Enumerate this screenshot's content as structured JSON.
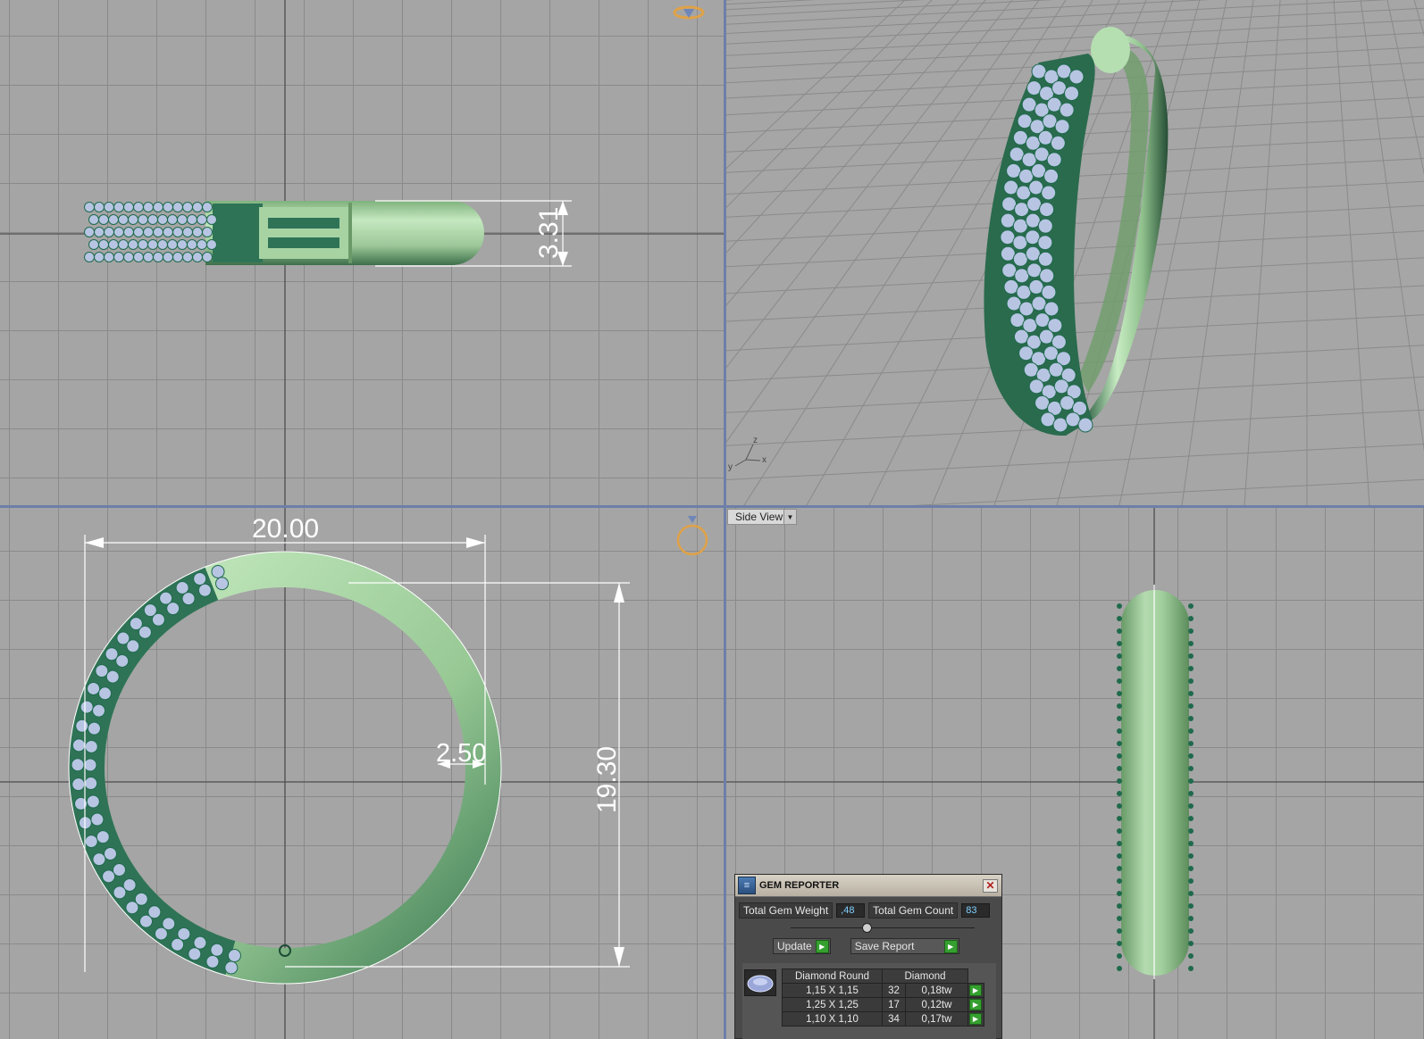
{
  "viewports": {
    "side": {
      "view_label": "Side View"
    }
  },
  "dimensions": {
    "thickness": "3.31",
    "width": "20.00",
    "height": "19.30",
    "band_width": "2.50"
  },
  "axes": {
    "x": "x",
    "y": "y",
    "z": "z"
  },
  "gem_reporter": {
    "title": "GEM REPORTER",
    "total_weight_label": "Total Gem Weight",
    "total_weight_value": ",48",
    "total_count_label": "Total Gem Count",
    "total_count_value": "83",
    "update_label": "Update",
    "save_report_label": "Save Report",
    "table": {
      "headers": [
        "Diamond Round",
        "Diamond"
      ],
      "rows": [
        {
          "size": "1,15 X 1,15",
          "count": "32",
          "weight": "0,18tw"
        },
        {
          "size": "1,25 X 1,25",
          "count": "17",
          "weight": "0,12tw"
        },
        {
          "size": "1,10 X 1,10",
          "count": "34",
          "weight": "0,17tw"
        }
      ]
    }
  },
  "colors": {
    "metal_light": "#a9d3a6",
    "metal_dark": "#2f7356",
    "gem": "#b7c5e3",
    "prong": "#1f6a4c",
    "gizmo": "#e0a247"
  },
  "icons": {
    "view_cube_top": "gem-gizmo-icon",
    "view_cube_front": "ring-gizmo-icon",
    "gem_thumbnail": "round-diamond-icon"
  }
}
